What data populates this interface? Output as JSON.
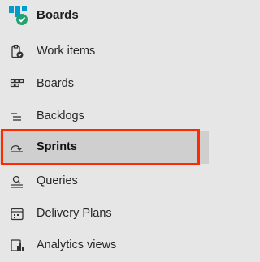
{
  "header": {
    "title": "Boards",
    "icon": "boards-app-icon",
    "accent": "#009CCC",
    "check_color": "#20A46F"
  },
  "nav": {
    "items": [
      {
        "label": "Work items",
        "icon": "work-items-icon"
      },
      {
        "label": "Boards",
        "icon": "boards-icon"
      },
      {
        "label": "Backlogs",
        "icon": "backlogs-icon"
      },
      {
        "label": "Sprints",
        "icon": "sprints-icon",
        "selected": true
      },
      {
        "label": "Queries",
        "icon": "queries-icon"
      },
      {
        "label": "Delivery Plans",
        "icon": "delivery-plans-icon"
      },
      {
        "label": "Analytics views",
        "icon": "analytics-views-icon"
      }
    ]
  },
  "highlight": {
    "color": "#FF2A00",
    "target": "Sprints"
  }
}
